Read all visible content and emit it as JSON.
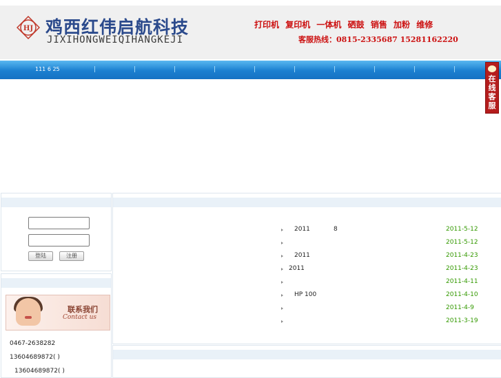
{
  "header": {
    "logo_mark": "HJ",
    "logo_cn": "鸡西红伟启航科技",
    "logo_en": "JIXIHONGWEIQIHANGKEJI",
    "services": [
      "打印机",
      "复印机",
      "一体机",
      "硒鼓",
      "销售",
      "加粉",
      "维修"
    ],
    "hotline": "客服热线：0815-2335687 15281162220"
  },
  "nav": {
    "items": [
      "111 6 25"
    ]
  },
  "kefu": {
    "label": "在线客服"
  },
  "login": {
    "username_value": "",
    "password_value": "",
    "login_label": "登陆",
    "register_label": "注册"
  },
  "contact": {
    "banner_cn": "联系我们",
    "banner_en": "Contact us",
    "phones": [
      "0467-2638282",
      "13604689872(  )",
      "13604689872(  )"
    ]
  },
  "news": {
    "rows": [
      {
        "title": "2011",
        "extra": "8",
        "date": "2011-5-12"
      },
      {
        "title": "",
        "extra": "",
        "date": "2011-5-12"
      },
      {
        "title": "2011",
        "extra": "",
        "date": "2011-4-23"
      },
      {
        "title": "2011",
        "extra": "",
        "date": "2011-4-23"
      },
      {
        "title": "",
        "extra": "",
        "date": "2011-4-11"
      },
      {
        "title": "HP 100",
        "extra": "",
        "date": "2011-4-10"
      },
      {
        "title": "",
        "extra": "",
        "date": "2011-4-9"
      },
      {
        "title": "",
        "extra": "",
        "date": "2011-3-19"
      }
    ]
  },
  "colors": {
    "brand_blue": "#2b4a8c",
    "accent_red": "#cc1111",
    "nav_blue": "#1b7fd0",
    "date_green": "#339900"
  }
}
